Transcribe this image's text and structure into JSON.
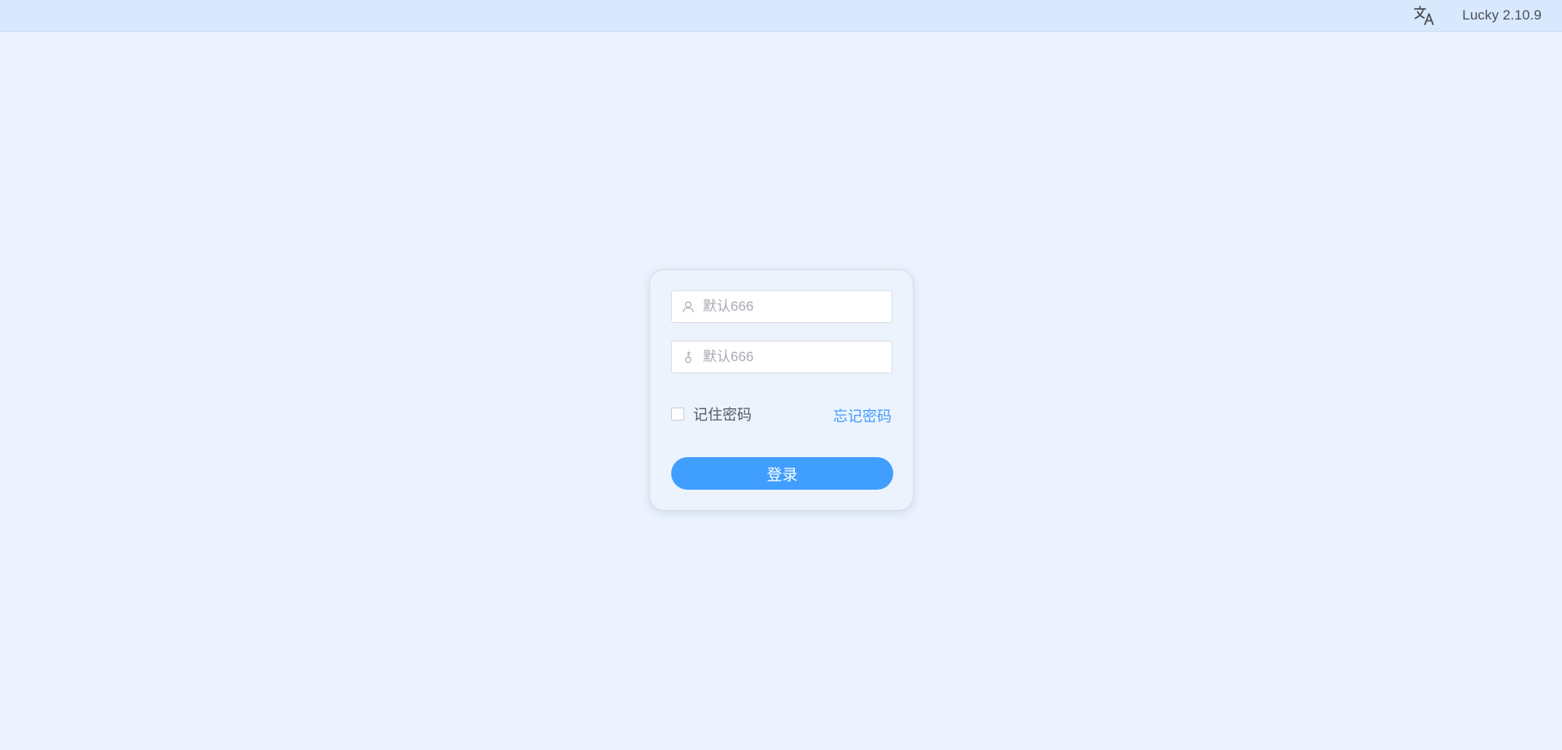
{
  "header": {
    "language_icon": "translate-icon",
    "version": "Lucky 2.10.9"
  },
  "login": {
    "username": {
      "icon": "user-icon",
      "value": "",
      "placeholder": "默认666"
    },
    "password": {
      "icon": "key-icon",
      "value": "",
      "placeholder": "默认666"
    },
    "remember_label": "记住密码",
    "remember_checked": false,
    "forgot_label": "忘记密码",
    "submit_label": "登录"
  },
  "colors": {
    "accent": "#409eff",
    "page_background": "#ecf3fe",
    "header_background": "#d9e9fd"
  }
}
